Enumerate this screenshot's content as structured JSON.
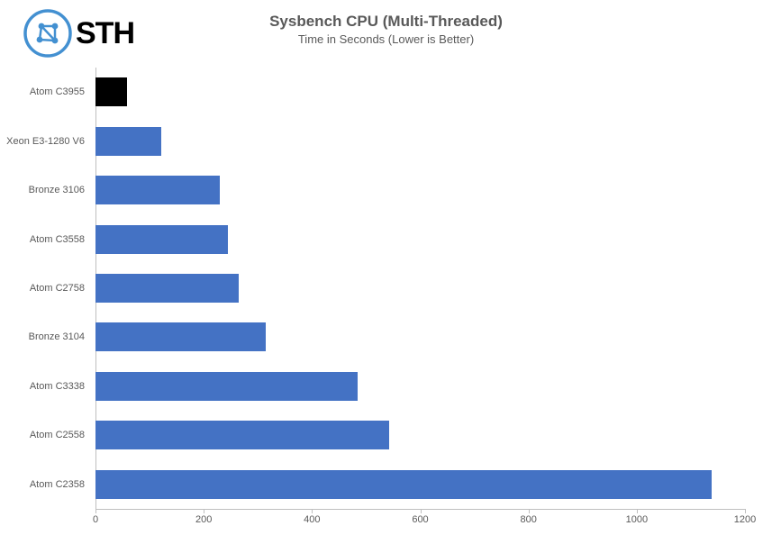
{
  "logo": {
    "text": "STH"
  },
  "chart_data": {
    "type": "bar",
    "title": "Sysbench CPU (Multi-Threaded)",
    "subtitle": "Time in Seconds (Lower is Better)",
    "xlabel": "",
    "ylabel": "",
    "xlim": [
      0,
      1200
    ],
    "x_ticks": [
      0,
      200,
      400,
      600,
      800,
      1000,
      1200
    ],
    "categories": [
      "Atom C3955",
      "Xeon E3-1280 V6",
      "Bronze 3106",
      "Atom C3558",
      "Atom C2758",
      "Bronze 3104",
      "Atom C3338",
      "Atom C2558",
      "Atom C2358"
    ],
    "values": [
      58,
      122,
      230,
      245,
      265,
      315,
      485,
      543,
      1138
    ],
    "highlight_index": 0,
    "colors": {
      "default": "#4472c4",
      "highlight": "#000000"
    }
  }
}
